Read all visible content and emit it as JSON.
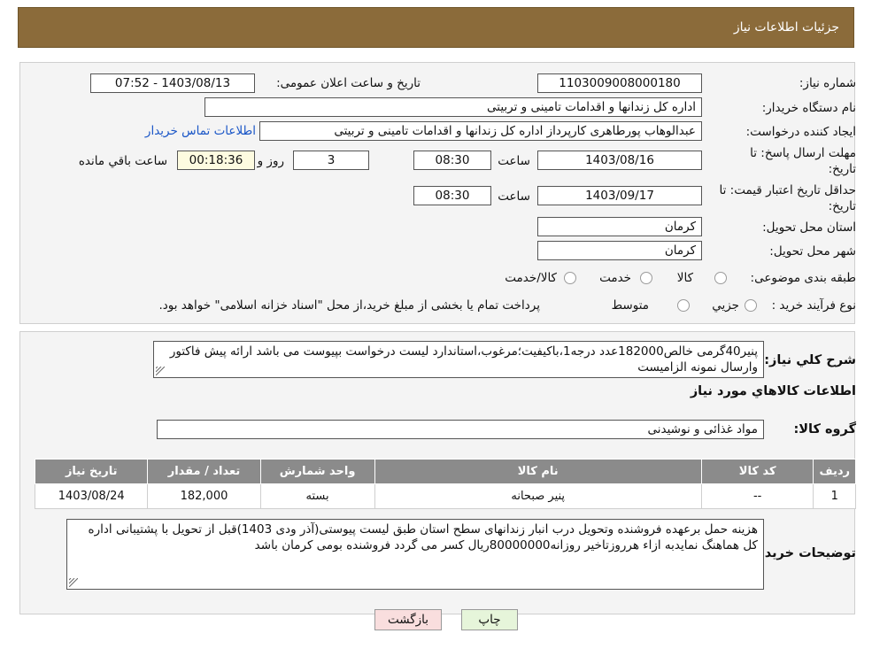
{
  "header": {
    "title": "جزئیات اطلاعات نیاز"
  },
  "form": {
    "need_number_label": "شماره نیاز:",
    "need_number": "1103009008000180",
    "announce_label": "تاریخ و ساعت اعلان عمومی:",
    "announce_value": "1403/08/13 - 07:52",
    "buyer_org_label": "نام دستگاه خریدار:",
    "buyer_org": "اداره کل زندانها و اقدامات تامینی و تربیتی",
    "requester_label": "ایجاد کننده درخواست:",
    "requester": "عبدالوهاب پورطاهری کارپرداز اداره کل زندانها و اقدامات تامینی و تربیتی",
    "contact_link": "اطلاعات تماس خریدار",
    "deadline_label": "مهلت ارسال پاسخ: تا",
    "deadline_label2": "تاریخ:",
    "deadline_date": "1403/08/16",
    "time_word": "ساعت",
    "deadline_time": "08:30",
    "days_value": "3",
    "days_word": "روز و",
    "remaining_time": "00:18:36",
    "remaining_word": "ساعت باقي مانده",
    "validity_label": "حداقل تاریخ اعتبار قیمت: تا",
    "validity_label2": "تاریخ:",
    "validity_date": "1403/09/17",
    "validity_time": "08:30",
    "province_label": "استان محل تحویل:",
    "province": "کرمان",
    "city_label": "شهر محل تحویل:",
    "city": "کرمان",
    "category_label": "طبقه بندی موضوعی:",
    "category_options": [
      "کالا",
      "خدمت",
      "کالا/خدمت"
    ],
    "process_label": "نوع فرآیند خرید :",
    "process_options": [
      "جزيي",
      "متوسط"
    ],
    "process_note": "پرداخت تمام یا بخشی از مبلغ خرید،از محل \"اسناد خزانه اسلامی\" خواهد بود."
  },
  "summary": {
    "label": "شرح کلي نياز:",
    "text": "پنیر40گرمی خالص182000عدد درجه1،باکیفیت؛مرغوب،استاندارد لیست درخواست بپیوست می باشد ارائه پیش فاکتور وارسال نمونه الزامیست",
    "goods_info_title": "اطلاعات کالاهاي مورد نياز",
    "group_label": "گروه کالا:",
    "group_value": "مواد غذائی و نوشیدنی"
  },
  "table": {
    "headers": [
      "رديف",
      "کد کالا",
      "نام کالا",
      "واحد شمارش",
      "تعداد / مقدار",
      "تاریخ نیاز"
    ],
    "rows": [
      [
        "1",
        "--",
        "پنیر صبحانه",
        "بسته",
        "182,000",
        "1403/08/24"
      ]
    ]
  },
  "buyer_notes": {
    "label": "توضیحات خریدار:",
    "text": "هزینه حمل برعهده فروشنده وتحویل درب انبار زندانهای سطح استان طبق لیست پیوستی(آذر ودی 1403)قبل از تحویل با پشتیبانی اداره کل هماهنگ نمایدبه ازاء هرروزتاخیر روزانه80000000ریال کسر می گردد فروشنده بومی کرمان باشد"
  },
  "buttons": {
    "print": "چاپ",
    "back": "بازگشت"
  },
  "colors": {
    "header_bg": "#8b6b3a",
    "table_header_bg": "#8b8b8b",
    "link": "#1a56c7",
    "back_button_bg": "#f9dede",
    "print_button_bg": "#e6f5da"
  }
}
